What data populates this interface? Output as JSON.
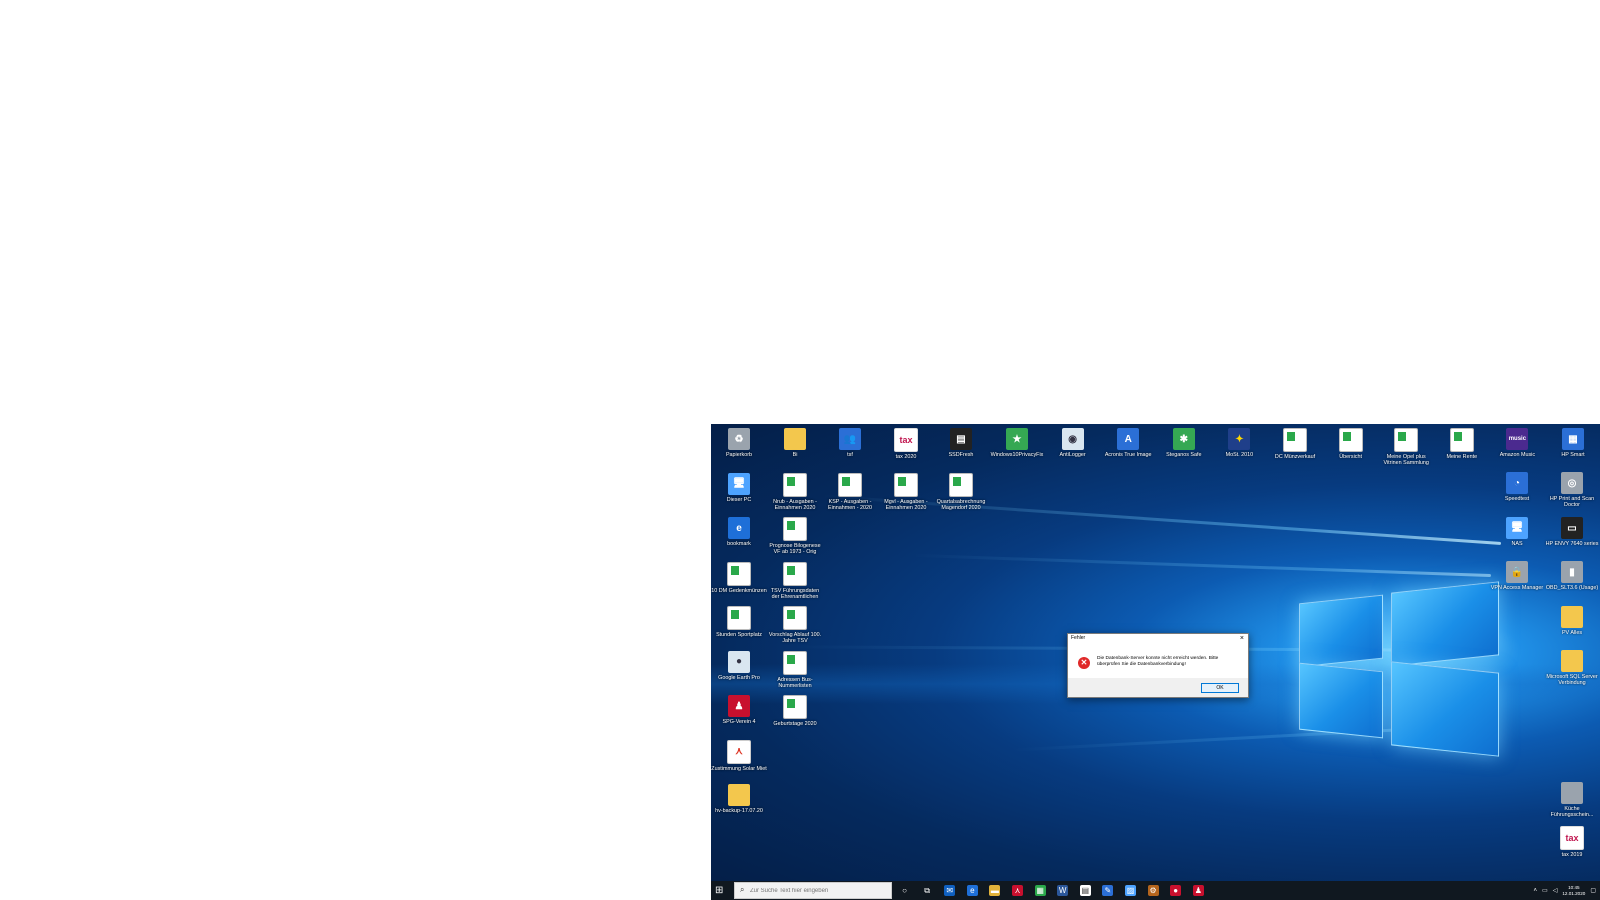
{
  "desktop": {
    "icons_left": [
      {
        "name": "recycle-bin-icon",
        "label": "Papierkorb",
        "style": "g-gray",
        "glyph": "♻"
      },
      {
        "name": "this-pc-icon",
        "label": "Dieser PC",
        "style": "g-pc",
        "glyph": "🖥"
      },
      {
        "name": "edge-bookmark-icon",
        "label": "bookmark",
        "style": "g-edge",
        "glyph": "e"
      },
      {
        "name": "excel-file-icon",
        "label": "10 DM Gedenkmünzen",
        "style": "g-doc",
        "glyph": ""
      },
      {
        "name": "excel-file-icon",
        "label": "Stunden Sportplatz",
        "style": "g-doc",
        "glyph": ""
      },
      {
        "name": "google-earth-icon",
        "label": "Google Earth Pro",
        "style": "g-globe",
        "glyph": "●"
      },
      {
        "name": "spg-verein-icon",
        "label": "SPG-Verein 4",
        "style": "g-red",
        "glyph": "♟"
      },
      {
        "name": "pdf-file-icon",
        "label": "Zustimmung Solar Miet",
        "style": "g-pdf",
        "glyph": "⋏"
      },
      {
        "name": "zip-folder-icon",
        "label": "hv-backup-17.07.20",
        "style": "g-folder",
        "glyph": ""
      }
    ],
    "icons_col2": [
      {
        "name": "folder-icon",
        "label": "Bi",
        "style": "g-folder",
        "glyph": ""
      },
      {
        "name": "excel-file-icon",
        "label": "Nrub - Ausgaben - Einnahmen 2020",
        "style": "g-doc",
        "glyph": ""
      },
      {
        "name": "excel-file-icon",
        "label": "Prognose Bilogenese VF ab 1973 - Orig",
        "style": "g-doc",
        "glyph": ""
      },
      {
        "name": "excel-file-icon",
        "label": "TSV Führungsdaten der Ehrenamtlichen",
        "style": "g-doc",
        "glyph": ""
      },
      {
        "name": "excel-file-icon",
        "label": "Vorschlag Ablauf 100. Jahre TSV",
        "style": "g-doc",
        "glyph": ""
      },
      {
        "name": "excel-file-icon",
        "label": "Adressen Bus-Nummerlisten",
        "style": "g-doc",
        "glyph": ""
      },
      {
        "name": "excel-file-icon",
        "label": "Geburtstage 2020",
        "style": "g-doc",
        "glyph": ""
      }
    ],
    "icons_col3": [
      {
        "name": "users-icon",
        "label": "tsf",
        "style": "g-blue",
        "glyph": "👥"
      },
      {
        "name": "excel-file-icon",
        "label": "KSP - Ausgaben - Einnahmen - 2020",
        "style": "g-doc",
        "glyph": ""
      }
    ],
    "icons_col4": [
      {
        "name": "tax-app-icon",
        "label": "tax 2020",
        "style": "g-tax",
        "glyph": "tax"
      },
      {
        "name": "excel-file-icon",
        "label": "Mgvl - Ausgaben - Einnahmen 2020",
        "style": "g-doc",
        "glyph": ""
      }
    ],
    "icons_col5": [
      {
        "name": "ssd-icon",
        "label": "SSDFresh",
        "style": "g-black",
        "glyph": "▤"
      },
      {
        "name": "excel-file-icon",
        "label": "Quartalsabrechnung Magendorf 2020",
        "style": "g-doc",
        "glyph": ""
      }
    ],
    "icons_top_row": [
      {
        "name": "privacy-shield-icon",
        "label": "Windows10PrivacyFix",
        "style": "g-green",
        "glyph": "★"
      },
      {
        "name": "antilogger-icon",
        "label": "AntiLogger",
        "style": "g-globe",
        "glyph": "◉"
      },
      {
        "name": "acronis-icon",
        "label": "Acronis True Image",
        "style": "g-blue",
        "glyph": "A"
      },
      {
        "name": "steganos-icon",
        "label": "Steganos Safe",
        "style": "g-green",
        "glyph": "✱"
      },
      {
        "name": "euro-app-icon",
        "label": "MoSt. 2010",
        "style": "g-star",
        "glyph": "✦"
      },
      {
        "name": "excel-file-icon",
        "label": "DC Münzverkauf",
        "style": "g-doc",
        "glyph": ""
      },
      {
        "name": "excel-file-icon",
        "label": "Übersicht",
        "style": "g-doc",
        "glyph": ""
      },
      {
        "name": "excel-file-icon",
        "label": "Meine Opel plus Vitrinen Sammlung",
        "style": "g-doc",
        "glyph": ""
      },
      {
        "name": "excel-file-icon",
        "label": "Meine Rente",
        "style": "g-doc",
        "glyph": ""
      },
      {
        "name": "amazon-music-icon",
        "label": "Amazon Music",
        "style": "g-amz",
        "glyph": "music"
      },
      {
        "name": "hp-smart-icon",
        "label": "HP Smart",
        "style": "g-blue",
        "glyph": "▦"
      }
    ],
    "icons_right": [
      {
        "name": "speedtest-icon",
        "label": "Speedtest",
        "style": "g-blue",
        "glyph": "◔"
      },
      {
        "name": "nas-icon",
        "label": "NAS",
        "style": "g-pc",
        "glyph": "🖥"
      },
      {
        "name": "vpn-access-icon",
        "label": "VPN Access Manager",
        "style": "g-gray",
        "glyph": "🔒"
      }
    ],
    "icons_far_right": [
      {
        "name": "hp-print-doctor-icon",
        "label": "HP Print and Scan Doctor",
        "style": "g-gray",
        "glyph": "◎"
      },
      {
        "name": "printer-icon",
        "label": "HP ENVY 7640 series",
        "style": "g-black",
        "glyph": "▭"
      },
      {
        "name": "usb-drive-icon",
        "label": "OBD_SLT3.6 (Usage)",
        "style": "g-gray",
        "glyph": "▮"
      },
      {
        "name": "folder-icon",
        "label": "PV Alles",
        "style": "g-folder",
        "glyph": ""
      },
      {
        "name": "folder-icon",
        "label": "Microsoft SQL Server Verbindung",
        "style": "g-folder",
        "glyph": ""
      },
      {
        "name": "document-icon",
        "label": "Küche Führungsschein...",
        "style": "g-gray",
        "glyph": ""
      },
      {
        "name": "tax-app-icon",
        "label": "tax 2019",
        "style": "g-tax",
        "glyph": "tax"
      }
    ]
  },
  "dialog": {
    "title": "Fehler",
    "message": "Die Datenbank-Server konnte nicht erreicht werden. Bitte überprüfen Sie die Datenbankverbindung!",
    "ok_label": "OK",
    "close_glyph": "×",
    "error_glyph": "✕"
  },
  "taskbar": {
    "search_placeholder": "Zur Suche Text hier eingeben",
    "clock_time": "10:45",
    "clock_date": "12.01.2020",
    "apps": [
      {
        "name": "cortana-icon",
        "glyph": "○",
        "color": "#101820"
      },
      {
        "name": "task-view-icon",
        "glyph": "⧉",
        "color": "#101820"
      },
      {
        "name": "outlook-icon",
        "glyph": "✉",
        "color": "#0f5fbf"
      },
      {
        "name": "edge-icon",
        "glyph": "e",
        "color": "#1e6fd8"
      },
      {
        "name": "explorer-icon",
        "glyph": "▬",
        "color": "#e2b23a"
      },
      {
        "name": "acrobat-icon",
        "glyph": "⋏",
        "color": "#c8102e"
      },
      {
        "name": "app-tiles-icon",
        "glyph": "▦",
        "color": "#2aa84a"
      },
      {
        "name": "word-icon",
        "glyph": "W",
        "color": "#2b579a"
      },
      {
        "name": "notepad-icon",
        "glyph": "▤",
        "color": "#ffffff"
      },
      {
        "name": "pen-app-icon",
        "glyph": "✎",
        "color": "#2b6fd6"
      },
      {
        "name": "photos-icon",
        "glyph": "▨",
        "color": "#4da3ff"
      },
      {
        "name": "tool-icon",
        "glyph": "⚙",
        "color": "#b5651d"
      },
      {
        "name": "record-icon",
        "glyph": "●",
        "color": "#c8102e"
      },
      {
        "name": "spg-taskbar-icon",
        "glyph": "♟",
        "color": "#c8102e"
      }
    ]
  }
}
